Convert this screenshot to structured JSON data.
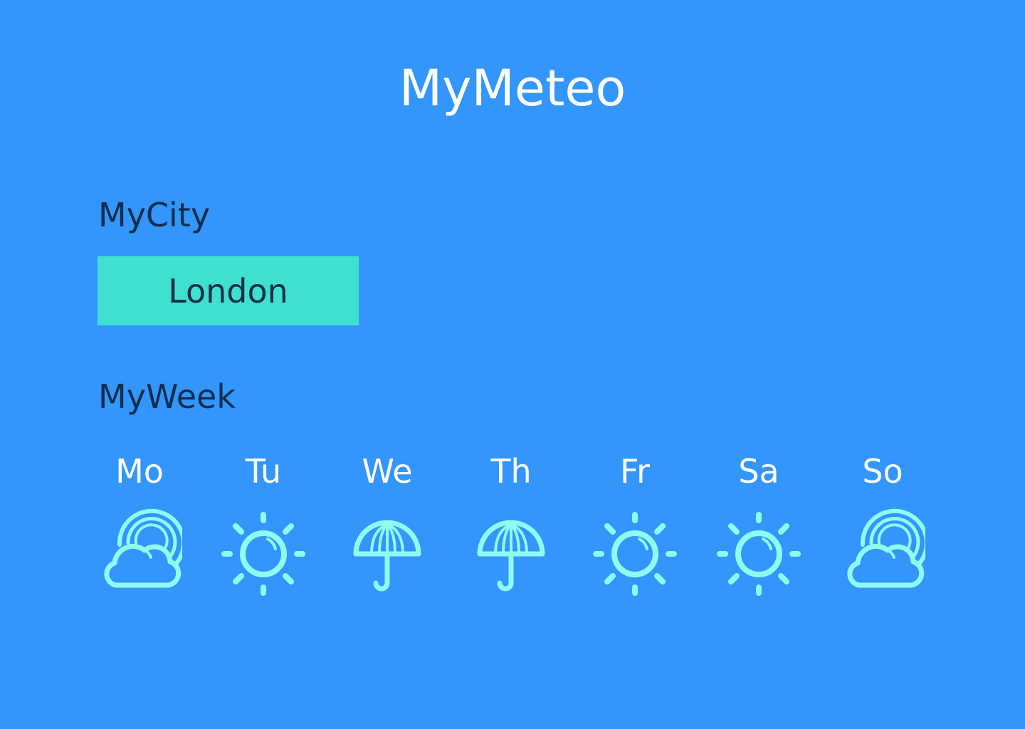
{
  "header": {
    "title": "MyMeteo"
  },
  "city": {
    "label": "MyCity",
    "selected": "London"
  },
  "week": {
    "label": "MyWeek",
    "icon_color": "#8ffcf0",
    "days": [
      {
        "name": "Mo",
        "icon": "cloud-sun-icon"
      },
      {
        "name": "Tu",
        "icon": "sun-icon"
      },
      {
        "name": "We",
        "icon": "umbrella-icon"
      },
      {
        "name": "Th",
        "icon": "umbrella-icon"
      },
      {
        "name": "Fr",
        "icon": "sun-icon"
      },
      {
        "name": "Sa",
        "icon": "sun-icon"
      },
      {
        "name": "So",
        "icon": "cloud-sun-icon"
      }
    ]
  },
  "colors": {
    "background": "#3396fd",
    "button": "#40e0d0",
    "dark_text": "#112d4e"
  }
}
